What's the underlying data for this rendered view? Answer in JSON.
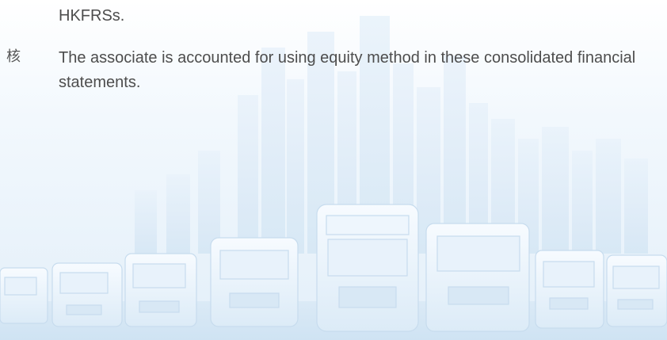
{
  "document": {
    "continued_line": "HKFRSs.",
    "item_marker": "核",
    "item_text": "The associate is accounted for using equity method in these consolidated financial statements."
  },
  "background": {
    "illustration": "city-skyline-and-truck-fleet-watermark",
    "tint_color": "#cfe4f3"
  }
}
